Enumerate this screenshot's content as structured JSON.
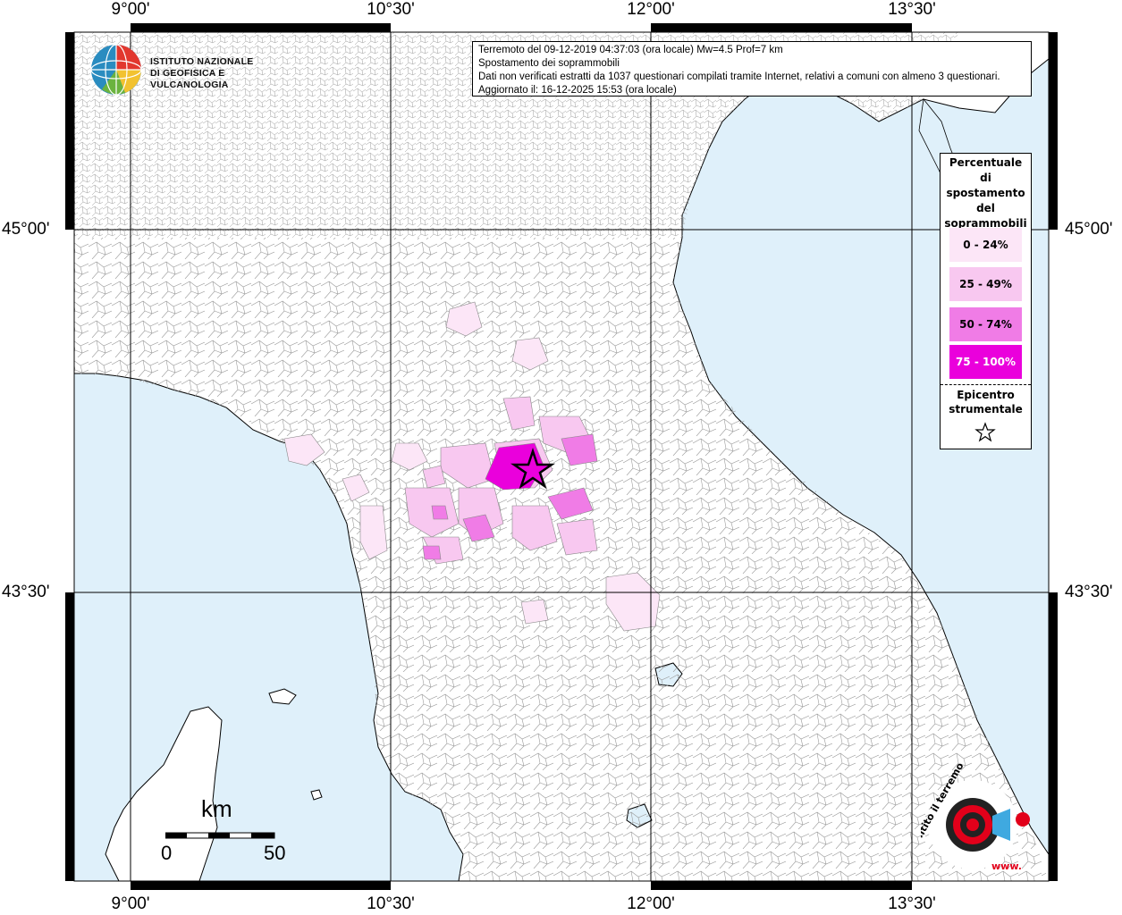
{
  "map": {
    "lon_labels": [
      "9°00'",
      "10°30'",
      "12°00'",
      "13°30'"
    ],
    "lat_labels": [
      "45°00'",
      "43°30'"
    ]
  },
  "info": {
    "line1": "Terremoto del 09-12-2019 04:37:03 (ora locale) Mw=4.5 Prof=7 km",
    "line2": "Spostamento dei soprammobili",
    "line3": "Dati non verificati estratti da 1037 questionari compilati tramite Internet, relativi a comuni con almeno 3 questionari.",
    "line4": "Aggiornato il: 16-12-2025 15:53 (ora locale)"
  },
  "logo": {
    "ingv_line1": "ISTITUTO NAZIONALE",
    "ingv_line2": "DI GEOFISICA E VULCANOLOGIA",
    "hs_text": "hai sentito il terremoto.it",
    "hs_url": "www."
  },
  "legend": {
    "title_lines": [
      "Percentuale",
      "di",
      "spostamento",
      "del",
      "soprammobili"
    ],
    "classes": [
      {
        "label": "0 - 24%",
        "color": "#fce6f7"
      },
      {
        "label": "25 - 49%",
        "color": "#f8c8f0"
      },
      {
        "label": "50 - 74%",
        "color": "#f07ce6"
      },
      {
        "label": "75 - 100%",
        "color": "#ea00dc"
      }
    ],
    "epicenter_line1": "Epicentro",
    "epicenter_line2": "strumentale"
  },
  "scale": {
    "unit": "km",
    "min": "0",
    "max": "50"
  },
  "colors": {
    "sea": "#dff0fa",
    "land": "#ffffff",
    "border": "#000000",
    "grid": "#000000"
  }
}
